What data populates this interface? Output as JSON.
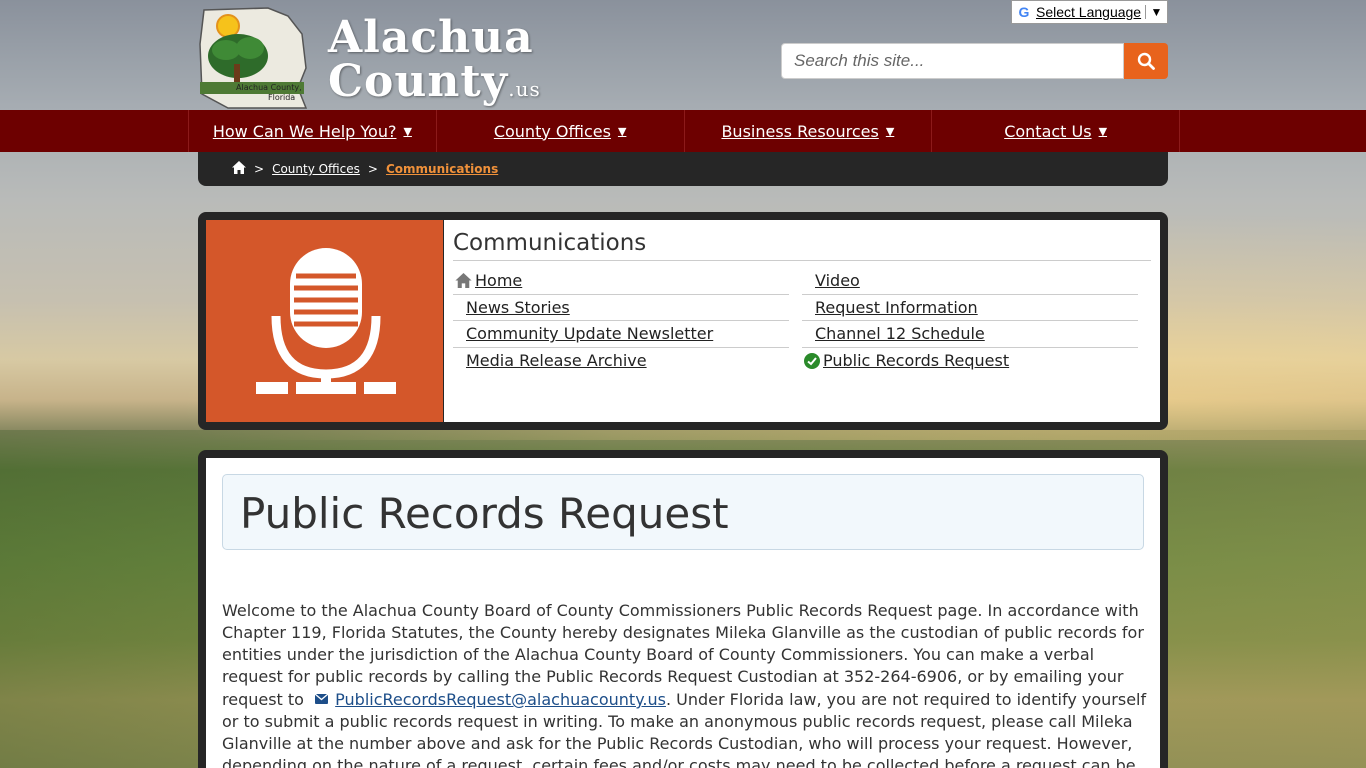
{
  "header": {
    "site_name_line1": "Alachua",
    "site_name_line2": "County",
    "site_tld": ".us",
    "logo_caption": "Alachua County, Florida",
    "language_label": "Select Language",
    "language_arrow": "▼",
    "search_placeholder": "Search this site...",
    "accent_color": "#e8631c"
  },
  "nav": {
    "items": [
      {
        "label": "How Can We Help You?",
        "arrow": "▼"
      },
      {
        "label": "County Offices",
        "arrow": "▼"
      },
      {
        "label": "Business Resources",
        "arrow": "▼"
      },
      {
        "label": "Contact Us",
        "arrow": "▼"
      }
    ],
    "bg_color": "#6d0000"
  },
  "breadcrumb": {
    "sep": ">",
    "items": [
      "County Offices"
    ],
    "current": "Communications"
  },
  "department": {
    "title": "Communications",
    "icon": "microphone-icon",
    "column1": [
      "Home",
      "News Stories",
      "Community Update Newsletter",
      "Media Release Archive"
    ],
    "column2": [
      "Video",
      "Request Information",
      "Channel 12 Schedule",
      "Public Records Request"
    ]
  },
  "page": {
    "title": "Public Records Request",
    "body_before_email": "Welcome to the Alachua County Board of County Commissioners Public Records Request page. In accordance with Chapter 119, Florida Statutes, the County hereby designates Mileka Glanville as the custodian of public records for entities under the jurisdiction of the Alachua County Board of County Commissioners. You can make a verbal request for public records by calling the Public Records Request Custodian at 352-264-6906, or by emailing your request to",
    "email": "PublicRecordsRequest@alachuacounty.us",
    "body_after_email": ". Under Florida law, you are not required to identify yourself or to submit a public records request in writing. To make an anonymous public records request, please call Mileka Glanville at the number above and ask for the Public Records Custodian, who will process your request. However, depending on the nature of a request, certain fees and/or costs may need to be collected before a request can be fulfilled. Therefore, a point of contact may be"
  }
}
